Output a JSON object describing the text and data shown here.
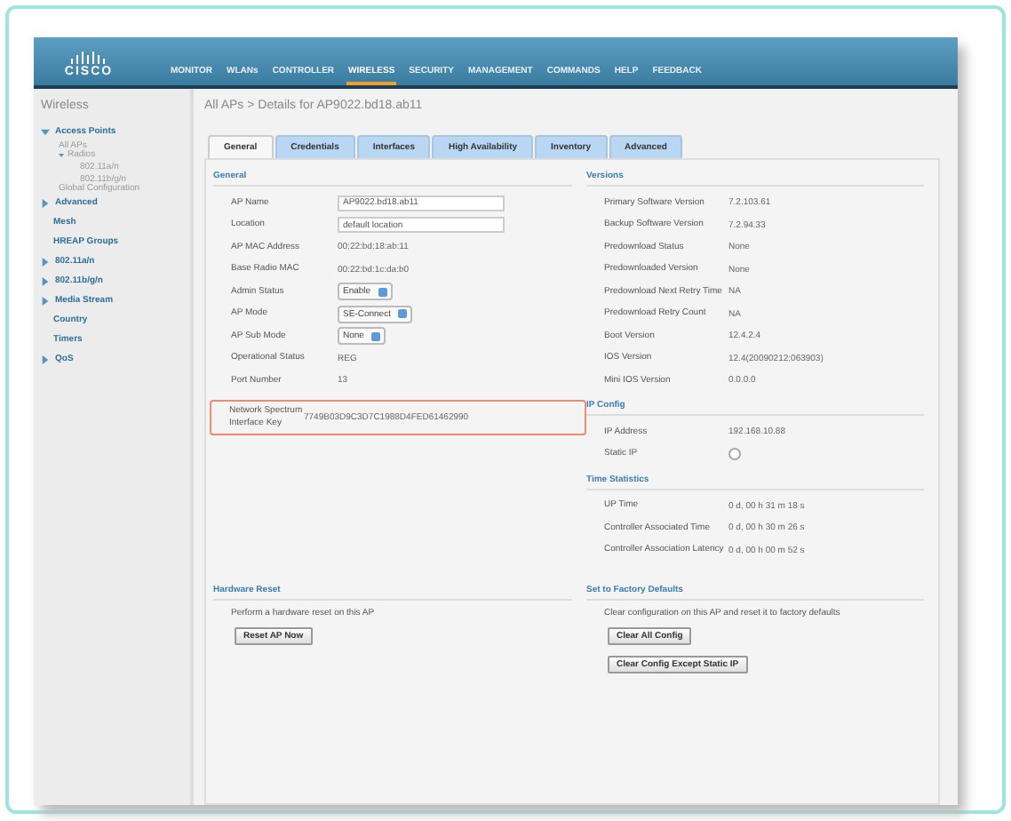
{
  "logo": {
    "text": "CISCO"
  },
  "nav": [
    {
      "label": "MONITOR",
      "selected": false
    },
    {
      "label": "WLANs",
      "selected": false
    },
    {
      "label": "CONTROLLER",
      "selected": false
    },
    {
      "label": "WIRELESS",
      "selected": true
    },
    {
      "label": "SECURITY",
      "selected": false
    },
    {
      "label": "MANAGEMENT",
      "selected": false
    },
    {
      "label": "COMMANDS",
      "selected": false
    },
    {
      "label": "HELP",
      "selected": false
    },
    {
      "label": "FEEDBACK",
      "selected": false
    }
  ],
  "sidebar": {
    "title": "Wireless",
    "items": [
      {
        "label": "Access Points",
        "kind": "section",
        "expanded": true,
        "children": [
          {
            "label": "All APs"
          },
          {
            "label": "Radios",
            "expanded": true,
            "children": [
              {
                "label": "802.11a/n"
              },
              {
                "label": "802.11b/g/n"
              }
            ]
          },
          {
            "label": "Global Configuration"
          }
        ]
      },
      {
        "label": "Advanced",
        "kind": "section",
        "expanded": false
      },
      {
        "label": "Mesh",
        "kind": "section"
      },
      {
        "label": "HREAP Groups",
        "kind": "section"
      },
      {
        "label": "802.11a/n",
        "kind": "section",
        "expanded": false
      },
      {
        "label": "802.11b/g/n",
        "kind": "section",
        "expanded": false
      },
      {
        "label": "Media Stream",
        "kind": "section",
        "expanded": false
      },
      {
        "label": "Country",
        "kind": "section"
      },
      {
        "label": "Timers",
        "kind": "section"
      },
      {
        "label": "QoS",
        "kind": "section",
        "expanded": false
      }
    ]
  },
  "breadcrumb": "All APs > Details for AP9022.bd18.ab11",
  "tabs": [
    {
      "label": "General",
      "selected": true
    },
    {
      "label": "Credentials",
      "selected": false
    },
    {
      "label": "Interfaces",
      "selected": false
    },
    {
      "label": "High Availability",
      "selected": false
    },
    {
      "label": "Inventory",
      "selected": false
    },
    {
      "label": "Advanced",
      "selected": false
    }
  ],
  "general": {
    "title": "General",
    "fields": [
      {
        "label": "AP Name",
        "kind": "input",
        "value": "AP9022.bd18.ab11"
      },
      {
        "label": "Location",
        "kind": "input",
        "value": "default location"
      },
      {
        "label": "AP MAC Address",
        "kind": "text",
        "value": "00:22:bd:18:ab:11"
      },
      {
        "label": "Base Radio MAC",
        "kind": "text",
        "value": "00:22:bd:1c:da:b0"
      },
      {
        "label": "Admin Status",
        "kind": "select",
        "value": "Enable"
      },
      {
        "label": "AP Mode",
        "kind": "select",
        "value": "SE-Connect"
      },
      {
        "label": "AP Sub Mode",
        "kind": "select",
        "value": "None"
      },
      {
        "label": "Operational Status",
        "kind": "text",
        "value": "REG"
      },
      {
        "label": "Port Number",
        "kind": "text",
        "value": "13"
      }
    ],
    "highlight": {
      "label": "Network Spectrum Interface Key",
      "value": "7749B03D9C3D7C1988D4FED61462990"
    }
  },
  "versions": {
    "title": "Versions",
    "fields": [
      {
        "label": "Primary Software Version",
        "value": "7.2.103.61"
      },
      {
        "label": "Backup Software Version",
        "value": "7.2.94.33"
      },
      {
        "label": "Predownload Status",
        "value": "None"
      },
      {
        "label": "Predownloaded Version",
        "value": "None"
      },
      {
        "label": "Predownload Next Retry Time",
        "value": "NA"
      },
      {
        "label": "Predownload Retry Count",
        "value": "NA"
      },
      {
        "label": "Boot Version",
        "value": "12.4.2.4"
      },
      {
        "label": "IOS Version",
        "value": "12.4(20090212:063903)"
      },
      {
        "label": "Mini IOS Version",
        "value": "0.0.0.0"
      }
    ]
  },
  "ip_config": {
    "title": "IP Config",
    "ip_label": "IP Address",
    "ip": "192.168.10.88",
    "static_label": "Static IP",
    "static_checked": false
  },
  "time_statistics": {
    "title": "Time Statistics",
    "fields": [
      {
        "label": "UP Time",
        "value": "0 d, 00 h 31 m 18 s"
      },
      {
        "label": "Controller Associated Time",
        "value": "0 d, 00 h 30 m 26 s"
      },
      {
        "label": "Controller Association Latency",
        "value": "0 d, 00 h 00 m 52 s"
      }
    ]
  },
  "hardware_reset": {
    "title": "Hardware Reset",
    "text": "Perform a hardware reset on this AP",
    "buttons": [
      "Reset AP Now"
    ]
  },
  "factory_defaults": {
    "title": "Set to Factory Defaults",
    "text": "Clear configuration on this AP and reset it to factory defaults",
    "buttons": [
      "Clear All Config",
      "Clear Config Except Static IP"
    ]
  }
}
